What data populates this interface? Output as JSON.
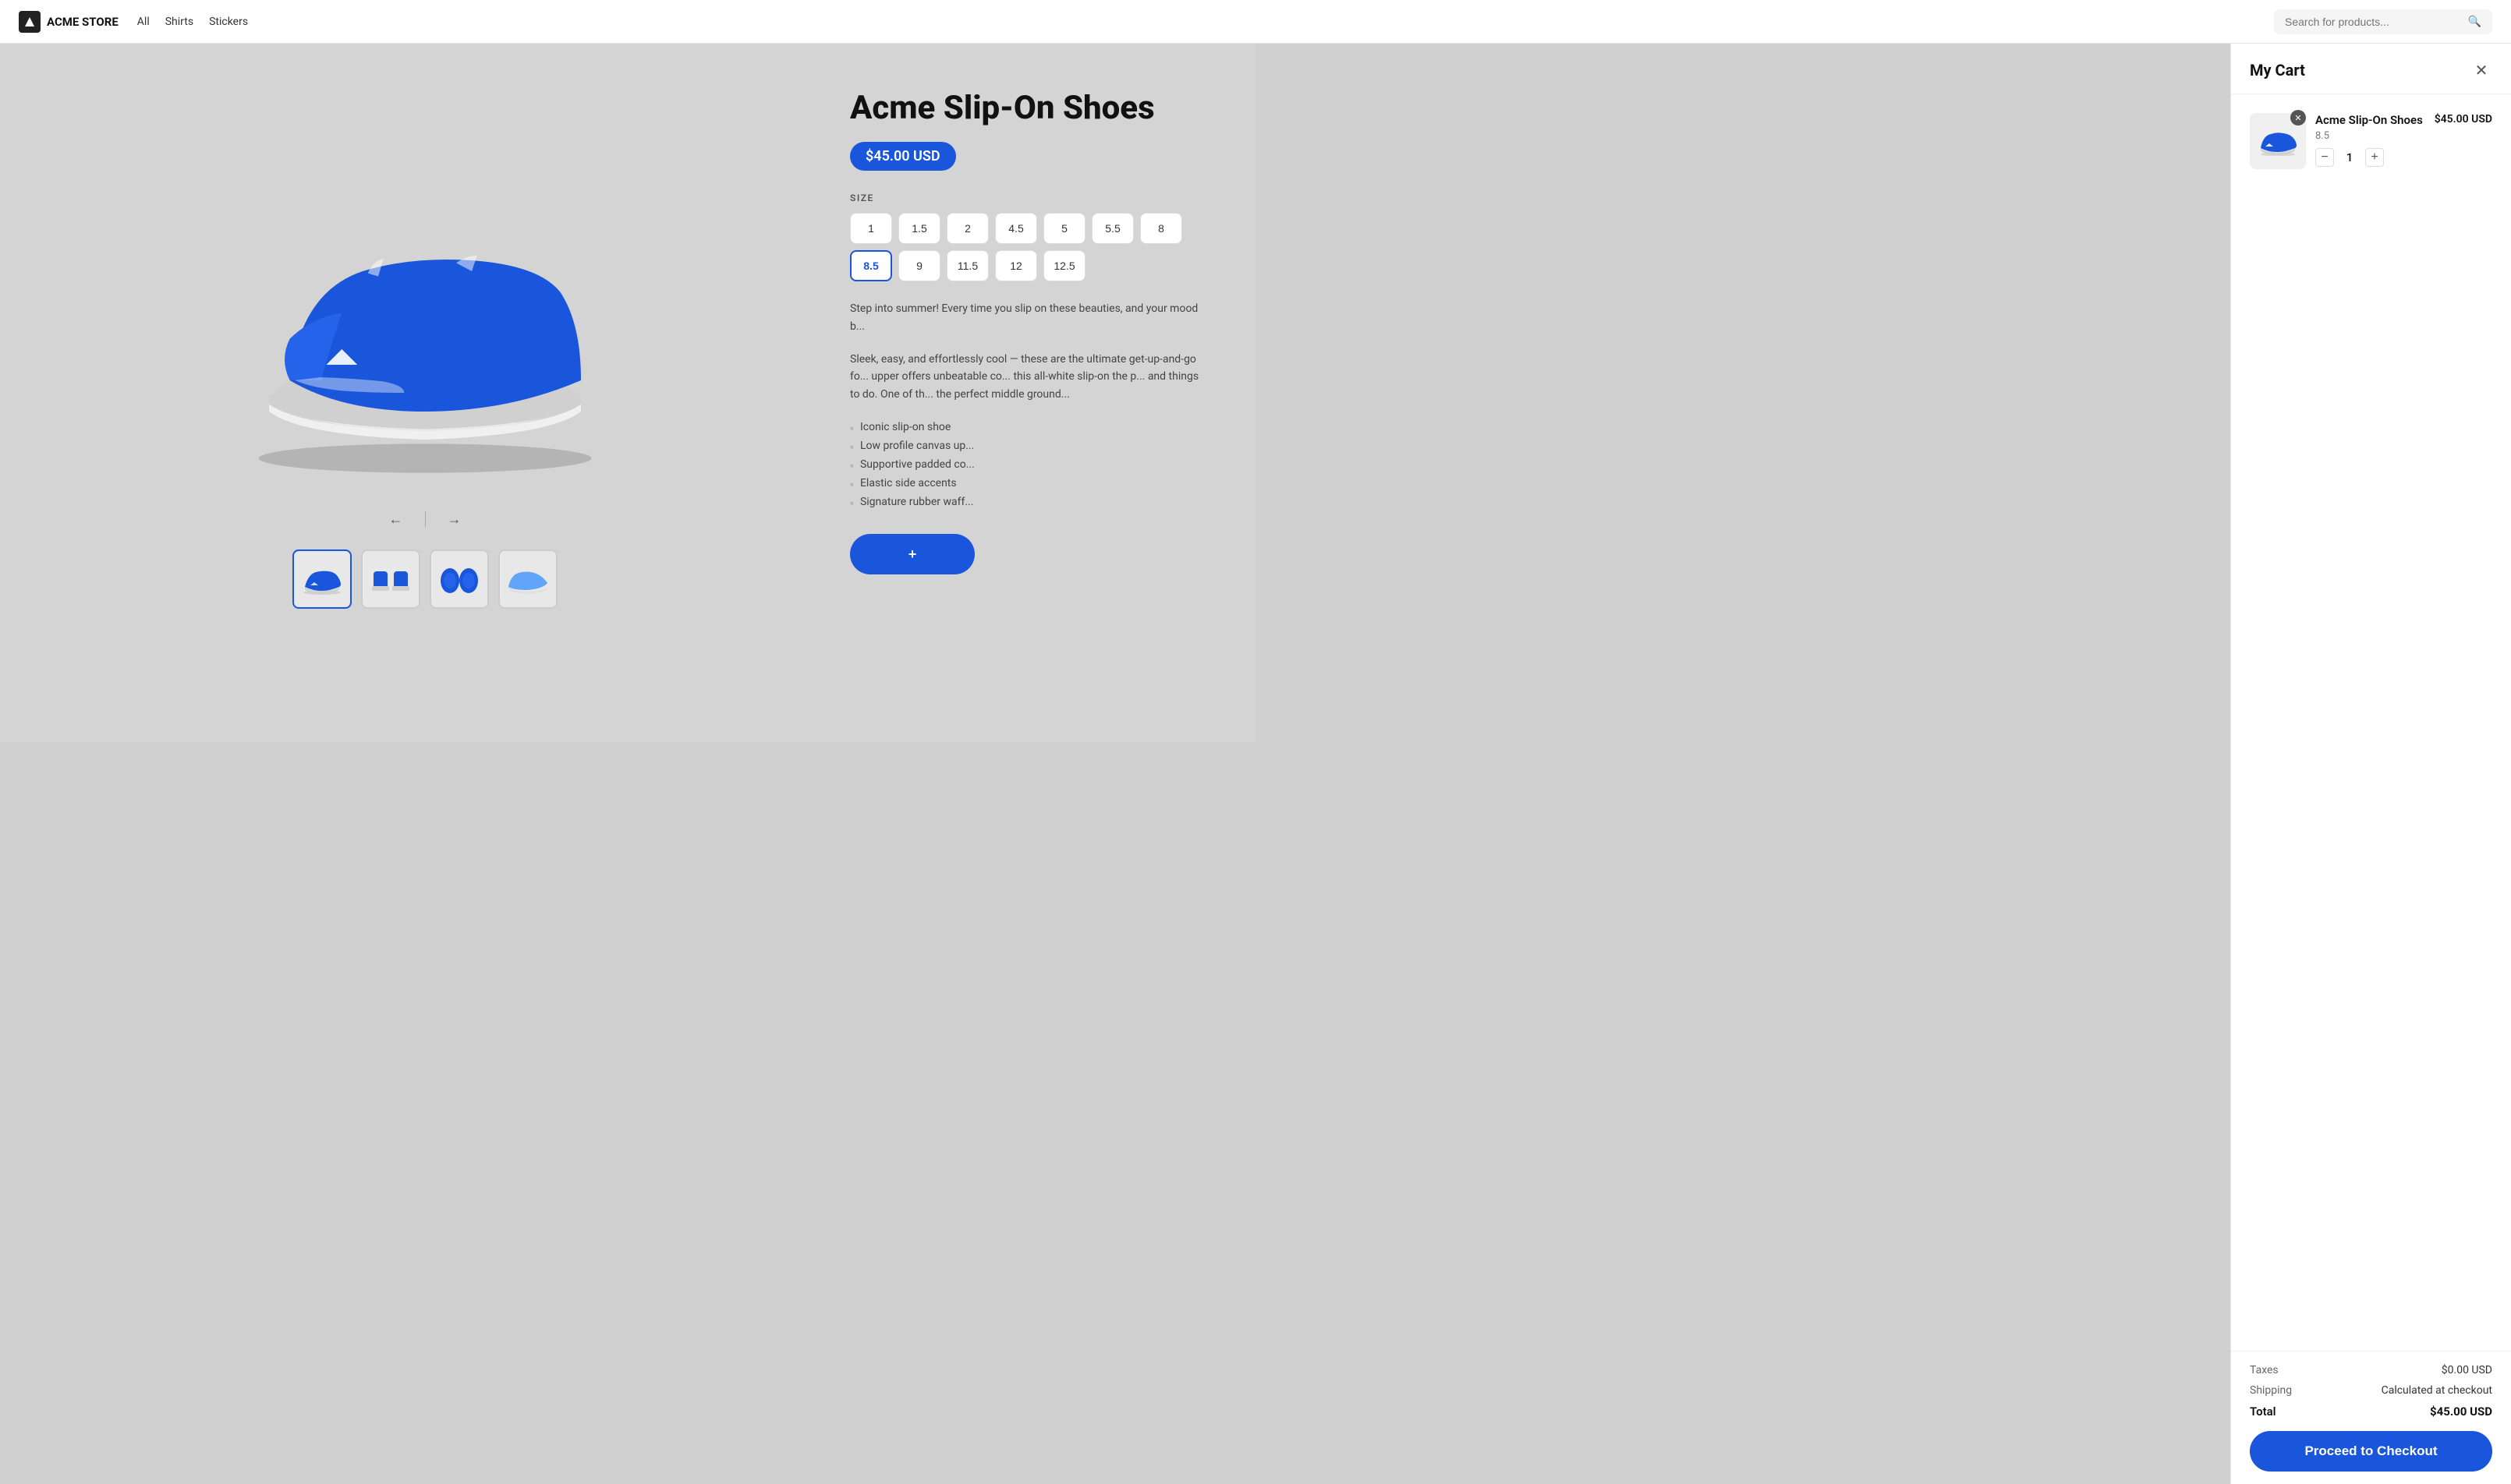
{
  "navbar": {
    "logo_text": "ACME STORE",
    "nav_links": [
      "All",
      "Shirts",
      "Stickers"
    ],
    "search_placeholder": "Search for products..."
  },
  "product": {
    "title": "Acme Slip-On Shoes",
    "price": "$45.00 USD",
    "size_label": "SIZE",
    "sizes": [
      "1",
      "1.5",
      "2",
      "4.5",
      "5",
      "5.5",
      "8",
      "8.5",
      "9",
      "11.5",
      "12",
      "12.5"
    ],
    "selected_size": "8.5",
    "description_1": "Step into summer! Every time you slip on these beauties, and your mood b...",
    "description_2": "Sleek, easy, and effortlessly cool — these are the ultimate get-up-and-go fo... upper offers unbeatable co... this all-white slip-on the p... and things to do. One of th... the perfect middle ground...",
    "features": [
      "Iconic slip-on shoe",
      "Low profile canvas up...",
      "Supportive padded co...",
      "Elastic side accents",
      "Signature rubber waff..."
    ],
    "add_btn_label": "+"
  },
  "cart": {
    "title": "My Cart",
    "close_label": "✕",
    "item": {
      "name": "Acme Slip-On Shoes",
      "price": "$45.00 USD",
      "size": "8.5",
      "quantity": 1,
      "remove_label": "✕"
    },
    "taxes_label": "Taxes",
    "taxes_value": "$0.00 USD",
    "shipping_label": "Shipping",
    "shipping_value": "Calculated at checkout",
    "total_label": "Total",
    "total_value": "$45.00 USD",
    "checkout_label": "Proceed to Checkout"
  }
}
